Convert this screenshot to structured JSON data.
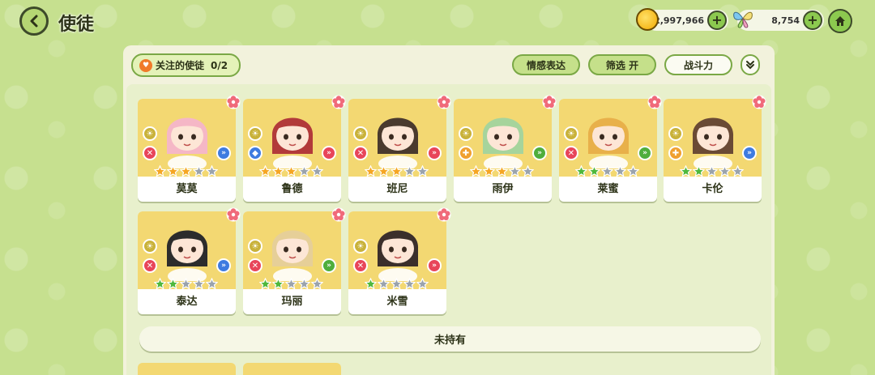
{
  "header": {
    "title": "使徒"
  },
  "currency": {
    "gold": "2,997,966",
    "gem": "8,754"
  },
  "toolbar": {
    "favorites_label": "关注的使徒",
    "favorites_count": "0/2",
    "emote_label": "情感表达",
    "filter_label": "筛选 开",
    "power_label": "战斗力"
  },
  "apostles": [
    {
      "name": "莫莫",
      "stars_filled": 3,
      "star_color": "gold",
      "role_top": "sun",
      "role_mid": "attack",
      "role_mid_color": "#e8455a",
      "side": "blue",
      "side_color": "#3e7be0",
      "hair": "#f5b7c6"
    },
    {
      "name": "鲁德",
      "stars_filled": 3,
      "star_color": "gold",
      "role_top": "sun",
      "role_mid": "shield",
      "role_mid_color": "#3e7be0",
      "side": "red",
      "side_color": "#e8455a",
      "hair": "#b23a3a"
    },
    {
      "name": "班尼",
      "stars_filled": 3,
      "star_color": "gold",
      "role_top": "sun",
      "role_mid": "attack",
      "role_mid_color": "#e8455a",
      "side": "red",
      "side_color": "#e8455a",
      "hair": "#4a3a2e"
    },
    {
      "name": "雨伊",
      "stars_filled": 3,
      "star_color": "gold",
      "role_top": "sun",
      "role_mid": "heal",
      "role_mid_color": "#f0a030",
      "side": "green",
      "side_color": "#4fae3c",
      "hair": "#a6d49c"
    },
    {
      "name": "莱蜜",
      "stars_filled": 2,
      "star_color": "green",
      "role_top": "sun",
      "role_mid": "attack",
      "role_mid_color": "#e8455a",
      "side": "green",
      "side_color": "#4fae3c",
      "hair": "#e8b04a"
    },
    {
      "name": "卡伦",
      "stars_filled": 2,
      "star_color": "green",
      "role_top": "sun",
      "role_mid": "heal",
      "role_mid_color": "#f0a030",
      "side": "blue",
      "side_color": "#3e7be0",
      "hair": "#6a4a35"
    },
    {
      "name": "泰达",
      "stars_filled": 2,
      "star_color": "green",
      "role_top": "sun",
      "role_mid": "attack",
      "role_mid_color": "#e8455a",
      "side": "blue",
      "side_color": "#3e7be0",
      "hair": "#2c2c2c"
    },
    {
      "name": "玛丽",
      "stars_filled": 2,
      "star_color": "green",
      "role_top": "sun",
      "role_mid": "attack",
      "role_mid_color": "#e8455a",
      "side": "green",
      "side_color": "#4fae3c",
      "hair": "#e6cf98"
    },
    {
      "name": "米雪",
      "stars_filled": 1,
      "star_color": "green",
      "role_top": "sun",
      "role_mid": "attack",
      "role_mid_color": "#e8455a",
      "side": "red",
      "side_color": "#e8455a",
      "hair": "#3b2f2b"
    }
  ],
  "sections": {
    "unowned_label": "未持有"
  },
  "colors": {
    "accent": "#8cc94f",
    "card_bg": "#f3d872",
    "star_gold": "#f5a623",
    "star_green": "#4fb83c",
    "star_empty": "#9aa3ad"
  }
}
